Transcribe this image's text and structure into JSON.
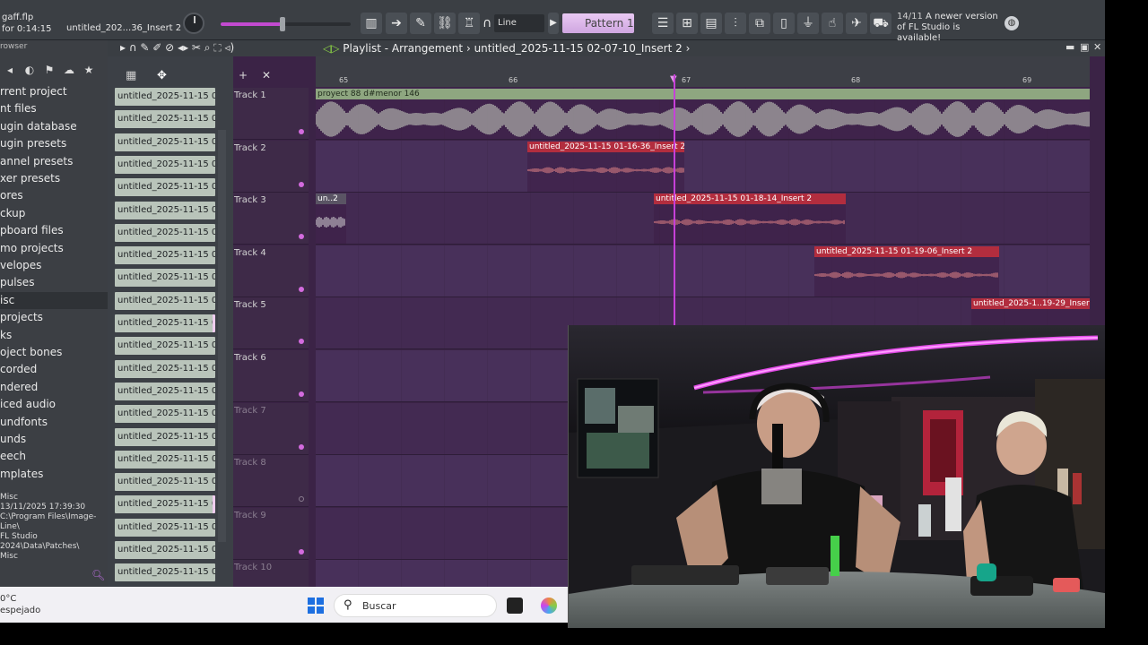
{
  "topbar": {
    "hint_file": "gaff.flp",
    "hint_time": "for 0:14:15",
    "hint_clip": "untitled_202...36_Insert 2",
    "snap_label": "Line",
    "pattern_label": "Pattern 1",
    "notice_date": "14/11",
    "notice_text": "A newer version of FL Studio is available!"
  },
  "browser": {
    "title": "rowser",
    "items": [
      "rrent project",
      "nt files",
      "ugin database",
      "ugin presets",
      "annel presets",
      "xer presets",
      "ores",
      "ckup",
      "pboard files",
      "mo projects",
      "velopes",
      "pulses",
      "isc",
      "projects",
      "ks",
      "oject bones",
      "corded",
      "ndered",
      "iced audio",
      "undfonts",
      "unds",
      "eech",
      "mplates"
    ],
    "info_name": "Misc",
    "info_date": "13/11/2025 17:39:30",
    "info_path1": "C:\\Program Files\\Image-Line\\",
    "info_path2": "FL Studio 2024\\Data\\Patches\\",
    "info_path3": "Misc"
  },
  "channels": {
    "label": "untitled_2025-11-15 01-..."
  },
  "playlist": {
    "title": "Playlist - Arrangement",
    "separator": "›",
    "project": "untitled_2025-11-15 02-07-10_Insert 2",
    "bars": [
      "65",
      "66",
      "67",
      "68",
      "69"
    ],
    "tracks": [
      "Track 1",
      "Track 2",
      "Track 3",
      "Track 4",
      "Track 5",
      "Track 6",
      "Track 7",
      "Track 8",
      "Track 9",
      "Track 10"
    ],
    "clips": {
      "t1": "proyect 88 d#menor 146",
      "t2": "untitled_2025-11-15 01-16-36_Insert 2",
      "t3a": "un..2",
      "t3b": "untitled_2025-11-15 01-18-14_Insert 2",
      "t4": "untitled_2025-11-15 01-19-06_Insert 2",
      "t5": "untitled_2025-1..19-29_Insert 2"
    }
  },
  "taskbar": {
    "temp": "0°C",
    "weather": "espejado",
    "search_placeholder": "Buscar"
  },
  "colors": {
    "accent": "#c640d8",
    "clip_red": "#b22d3e",
    "clip_green": "#8ea680",
    "playlist_bg": "#432a52"
  }
}
